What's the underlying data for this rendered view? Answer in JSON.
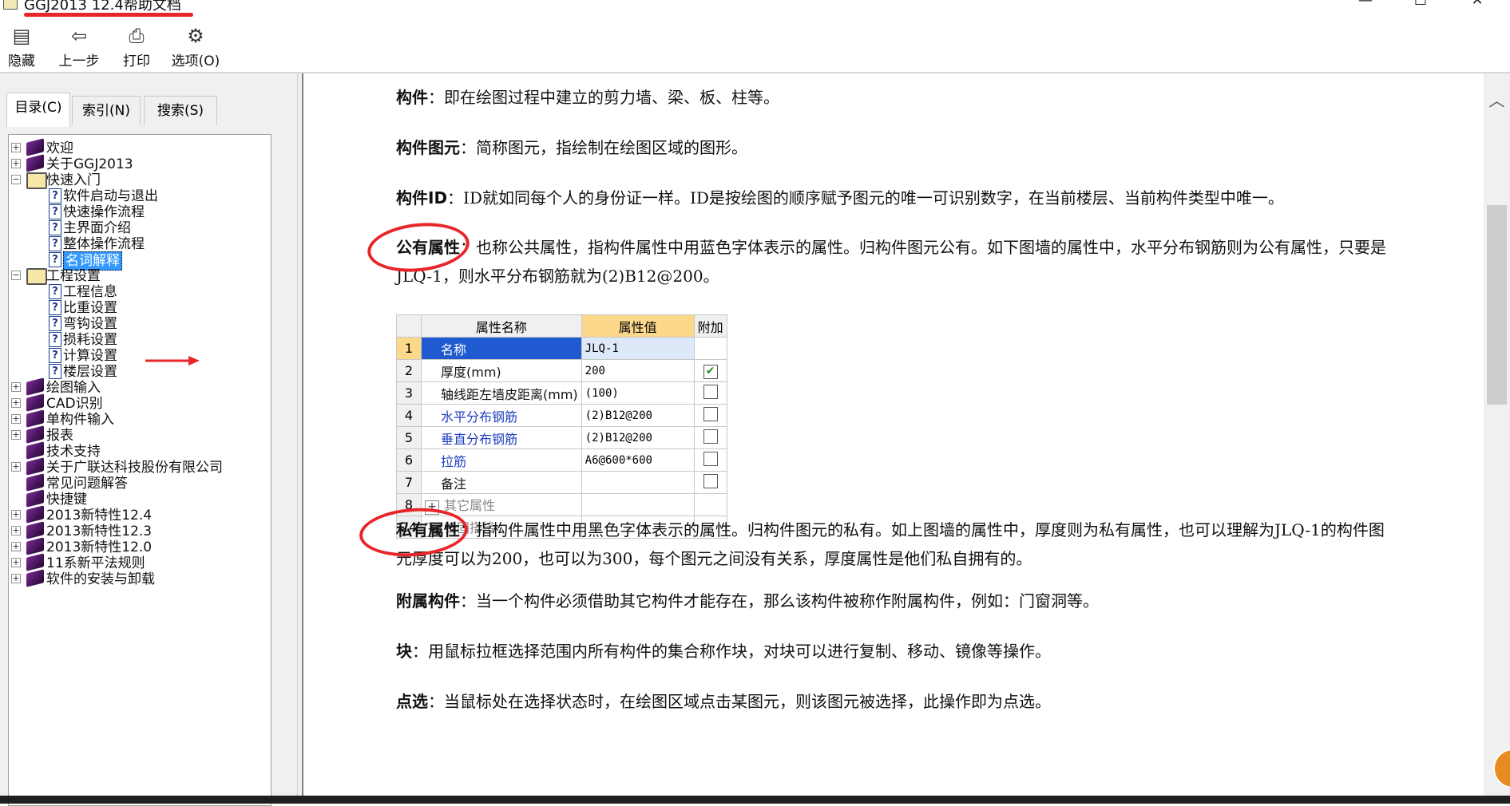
{
  "window": {
    "title": "GGJ2013 12.4帮助文档",
    "minimize": "—",
    "maximize": "☐",
    "close": "✕"
  },
  "toolbar": {
    "items": [
      {
        "label": "隐藏",
        "icon": "hide-icon"
      },
      {
        "label": "上一步",
        "icon": "back-arrow-icon"
      },
      {
        "label": "打印",
        "icon": "printer-icon"
      },
      {
        "label": "选项(O)",
        "icon": "options-icon"
      }
    ]
  },
  "tabs": [
    {
      "label": "目录(C)",
      "active": true
    },
    {
      "label": "索引(N)",
      "active": false
    },
    {
      "label": "搜索(S)",
      "active": false
    }
  ],
  "tree": [
    {
      "label": "欢迎",
      "type": "book",
      "expander": "+",
      "level": 0
    },
    {
      "label": "关于GGJ2013",
      "type": "book",
      "expander": "+",
      "level": 0
    },
    {
      "label": "快速入门",
      "type": "open-book",
      "expander": "−",
      "level": 0
    },
    {
      "label": "软件启动与退出",
      "type": "page",
      "level": 1
    },
    {
      "label": "快速操作流程",
      "type": "page",
      "level": 1
    },
    {
      "label": "主界面介绍",
      "type": "page",
      "level": 1
    },
    {
      "label": "整体操作流程",
      "type": "page",
      "level": 1
    },
    {
      "label": "名词解释",
      "type": "page",
      "level": 1,
      "selected": true
    },
    {
      "label": "工程设置",
      "type": "open-book",
      "expander": "−",
      "level": 0
    },
    {
      "label": "工程信息",
      "type": "page",
      "level": 1
    },
    {
      "label": "比重设置",
      "type": "page",
      "level": 1
    },
    {
      "label": "弯钩设置",
      "type": "page",
      "level": 1
    },
    {
      "label": "损耗设置",
      "type": "page",
      "level": 1
    },
    {
      "label": "计算设置",
      "type": "page",
      "level": 1
    },
    {
      "label": "楼层设置",
      "type": "page",
      "level": 1
    },
    {
      "label": "绘图输入",
      "type": "book",
      "expander": "+",
      "level": 0
    },
    {
      "label": "CAD识别",
      "type": "book",
      "expander": "+",
      "level": 0
    },
    {
      "label": "单构件输入",
      "type": "book",
      "expander": "+",
      "level": 0
    },
    {
      "label": "报表",
      "type": "book",
      "expander": "+",
      "level": 0
    },
    {
      "label": "技术支持",
      "type": "book",
      "level": 0
    },
    {
      "label": "关于广联达科技股份有限公司",
      "type": "book",
      "expander": "+",
      "level": 0
    },
    {
      "label": "常见问题解答",
      "type": "book",
      "level": 0
    },
    {
      "label": "快捷键",
      "type": "book",
      "level": 0
    },
    {
      "label": "2013新特性12.4",
      "type": "book",
      "expander": "+",
      "level": 0
    },
    {
      "label": "2013新特性12.3",
      "type": "book",
      "expander": "+",
      "level": 0
    },
    {
      "label": "2013新特性12.0",
      "type": "book",
      "expander": "+",
      "level": 0
    },
    {
      "label": "11系新平法规则",
      "type": "book",
      "expander": "+",
      "level": 0
    },
    {
      "label": "软件的安装与卸载",
      "type": "book",
      "expander": "+",
      "level": 0
    }
  ],
  "content": {
    "p1": {
      "term": "构件",
      "text": "：即在绘图过程中建立的剪力墙、梁、板、柱等。"
    },
    "p2": {
      "term": "构件图元",
      "text": "：简称图元，指绘制在绘图区域的图形。"
    },
    "p3": {
      "term": "构件ID",
      "text": "：ID就如同每个人的身份证一样。ID是按绘图的顺序赋予图元的唯一可识别数字，在当前楼层、当前构件类型中唯一。"
    },
    "p4": {
      "term": "公有属性",
      "text": "：也称公共属性，指构件属性中用蓝色字体表示的属性。归构件图元公有。如下图墙的属性中，水平分布钢筋则为公有属性，只要是JLQ-1，则水平分布钢筋就为(2)B12@200。"
    },
    "p5": {
      "term": "私有属性",
      "text": "：指构件属性中用黑色字体表示的属性。归构件图元的私有。如上图墙的属性中，厚度则为私有属性，也可以理解为JLQ-1的构件图元厚度可以为200，也可以为300，每个图元之间没有关系，厚度属性是他们私自拥有的。"
    },
    "p6": {
      "term": "附属构件",
      "text": "：当一个构件必须借助其它构件才能存在，那么该构件被称作附属构件，例如：门窗洞等。"
    },
    "p7": {
      "term": "块",
      "text": "：用鼠标拉框选择范围内所有构件的集合称作块，对块可以进行复制、移动、镜像等操作。"
    },
    "p8": {
      "term": "点选",
      "text": "：当鼠标处在选择状态时，在绘图区域点击某图元，则该图元被选择，此操作即为点选。"
    }
  },
  "property_table": {
    "headers": [
      "属性名称",
      "属性值",
      "附加"
    ],
    "rows": [
      {
        "num": "1",
        "name": "名称",
        "value": "JLQ-1",
        "color": "#1f3fc0",
        "checkbox": false
      },
      {
        "num": "2",
        "name": "厚度(mm)",
        "value": "200",
        "color": "#111111",
        "checkbox": true,
        "checked": true
      },
      {
        "num": "3",
        "name": "轴线距左墙皮距离(mm)",
        "value": "(100)",
        "color": "#111111",
        "checkbox": true
      },
      {
        "num": "4",
        "name": "水平分布钢筋",
        "value": "(2)B12@200",
        "color": "#1f3fc0",
        "checkbox": true
      },
      {
        "num": "5",
        "name": "垂直分布钢筋",
        "value": "(2)B12@200",
        "color": "#1f3fc0",
        "checkbox": true
      },
      {
        "num": "6",
        "name": "拉筋",
        "value": "A6@600*600",
        "color": "#1f3fc0",
        "checkbox": true
      },
      {
        "num": "7",
        "name": "备注",
        "value": "",
        "color": "#111111",
        "checkbox": true
      },
      {
        "num": "8",
        "name": "其它属性",
        "value": "",
        "color": "#888888",
        "expander": "+"
      },
      {
        "num": "24",
        "name": "锚固搭接",
        "value": "",
        "color": "#888888",
        "expander": "+"
      }
    ]
  },
  "colors": {
    "annotation_red": "#e8262a",
    "selection_blue": "#3399ff",
    "header_orange": "#fbd88a",
    "public_attr_blue": "#1f3fc0"
  }
}
